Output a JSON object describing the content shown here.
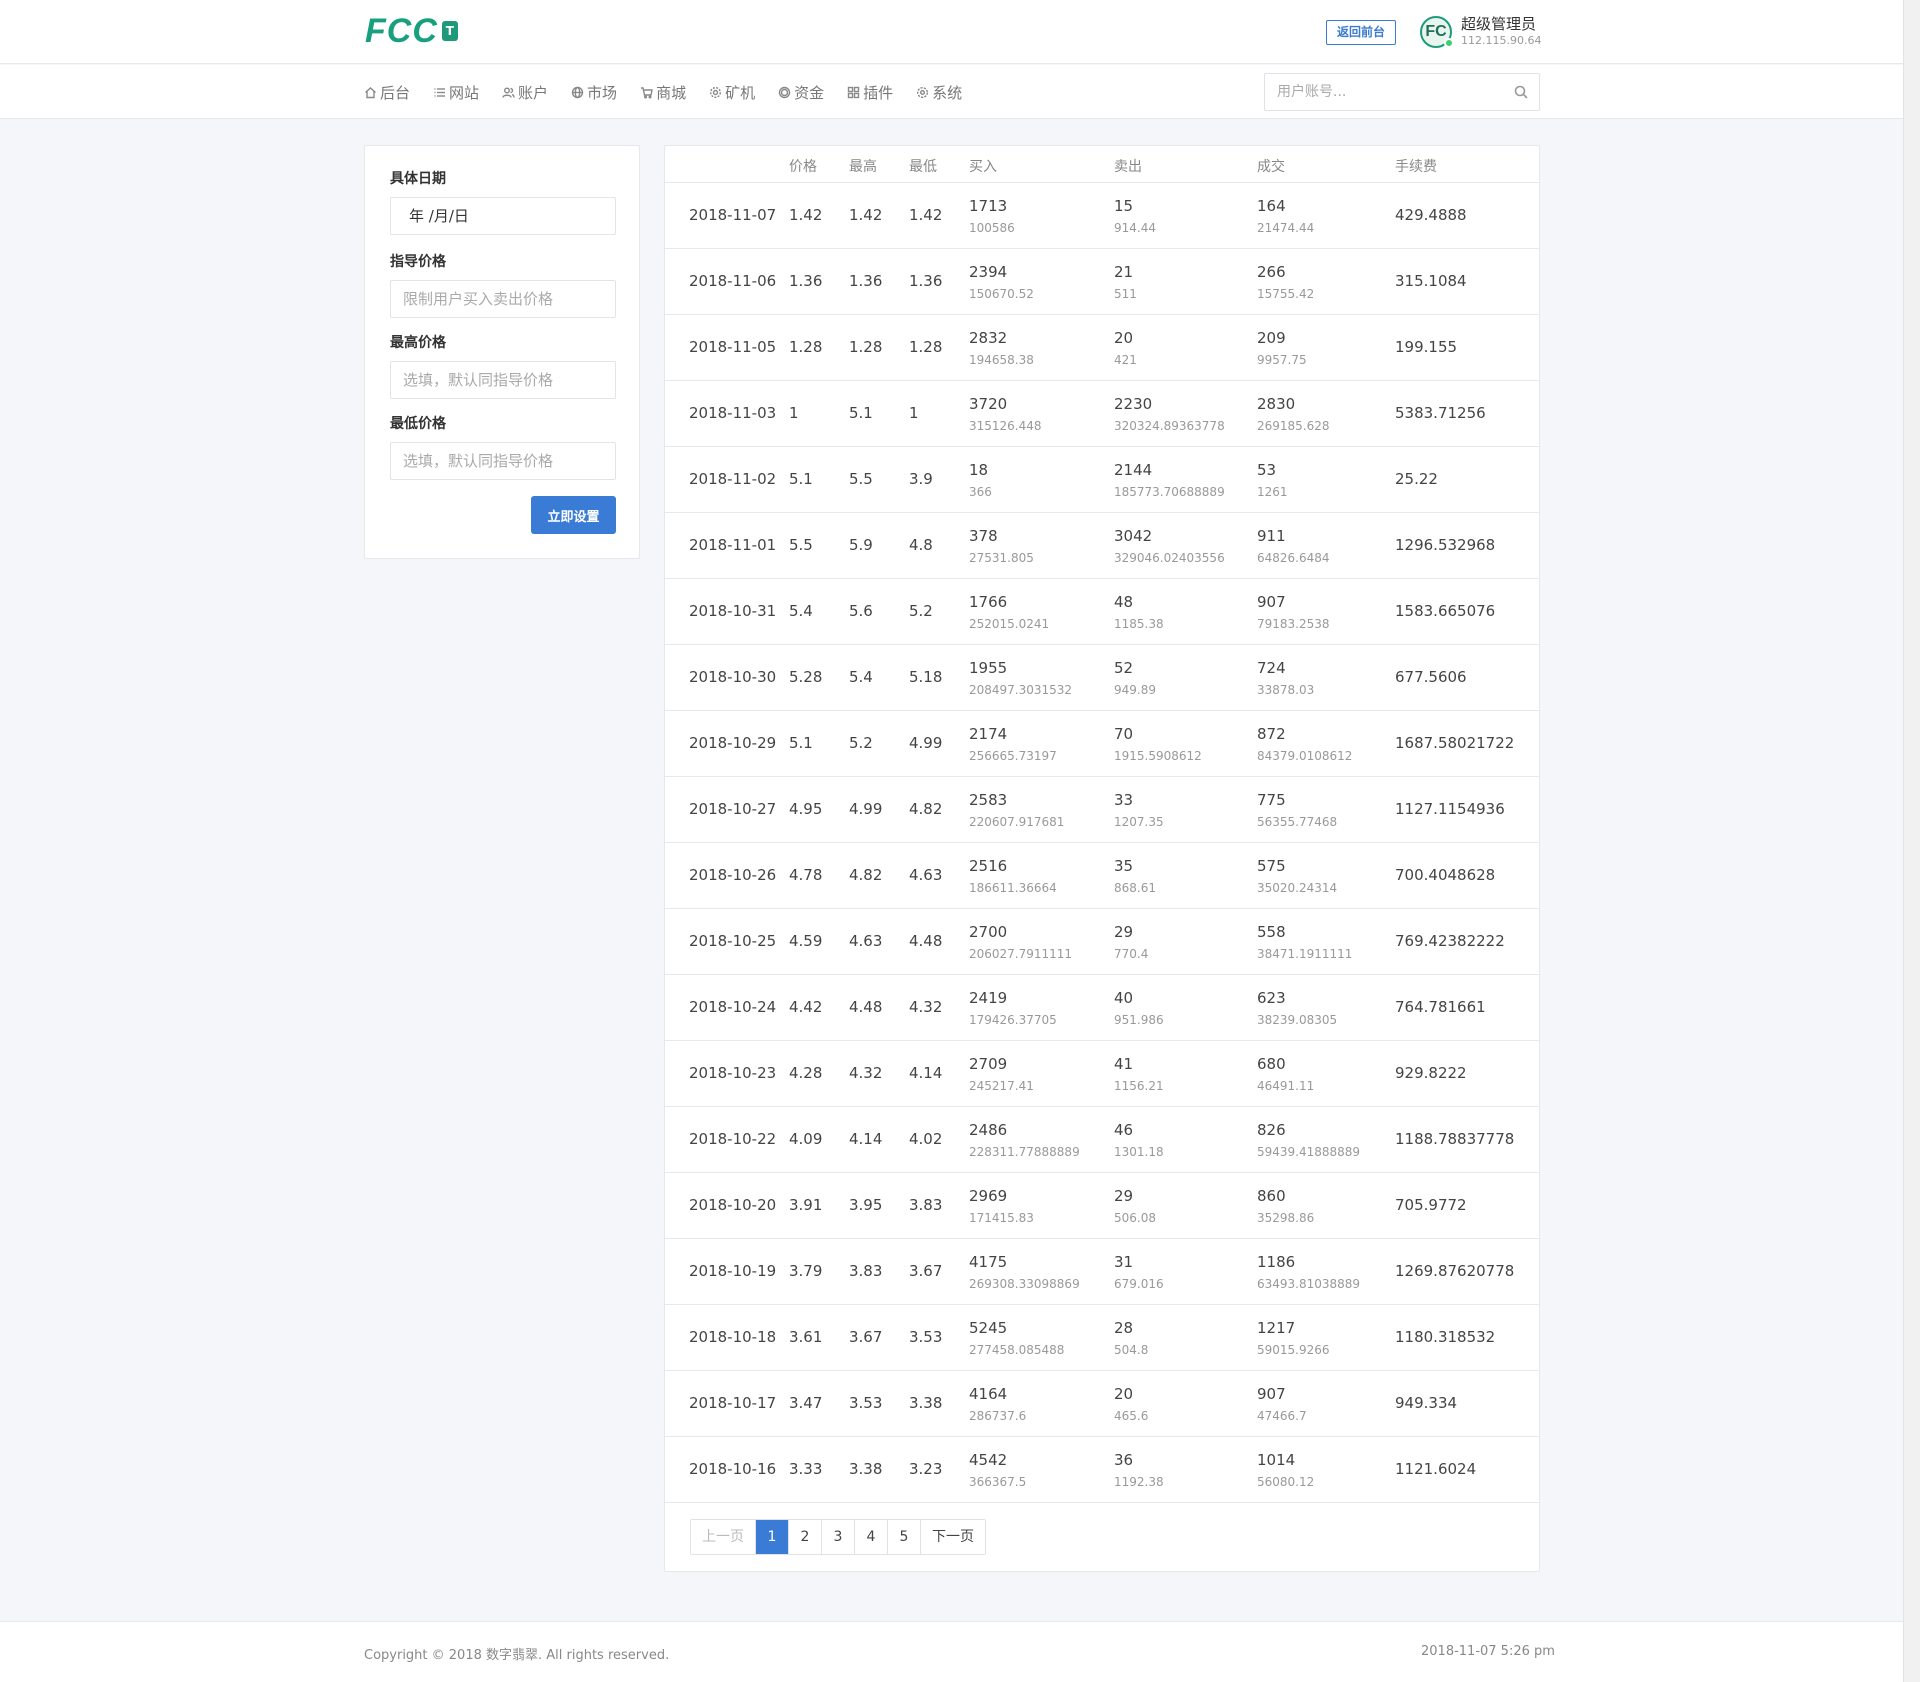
{
  "header": {
    "logo_text": "FCC",
    "logo_badge": "T",
    "front_button": "返回前台",
    "avatar_text": "FC",
    "user_name": "超级管理员",
    "user_ip": "112.115.90.64"
  },
  "nav": {
    "items": [
      {
        "label": "后台",
        "icon": "home-icon"
      },
      {
        "label": "网站",
        "icon": "list-icon"
      },
      {
        "label": "账户",
        "icon": "users-icon"
      },
      {
        "label": "市场",
        "icon": "globe-icon"
      },
      {
        "label": "商城",
        "icon": "cart-icon"
      },
      {
        "label": "矿机",
        "icon": "gear-icon"
      },
      {
        "label": "资金",
        "icon": "coin-icon"
      },
      {
        "label": "插件",
        "icon": "grid-icon"
      },
      {
        "label": "系统",
        "icon": "settings-icon"
      }
    ],
    "search_placeholder": "用户账号..."
  },
  "form": {
    "date_label": "具体日期",
    "date_value": "年 /月/日",
    "guide_label": "指导价格",
    "guide_placeholder": "限制用户买入卖出价格",
    "high_label": "最高价格",
    "high_placeholder": "选填，默认同指导价格",
    "low_label": "最低价格",
    "low_placeholder": "选填，默认同指导价格",
    "submit": "立即设置"
  },
  "table": {
    "headers": [
      "",
      "价格",
      "最高",
      "最低",
      "买入",
      "卖出",
      "成交",
      "手续费"
    ],
    "rows": [
      {
        "date": "2018-11-07",
        "price": "1.42",
        "high": "1.42",
        "low": "1.42",
        "buy": "1713",
        "buy_sub": "100586",
        "sell": "15",
        "sell_sub": "914.44",
        "deal": "164",
        "deal_sub": "21474.44",
        "fee": "429.4888"
      },
      {
        "date": "2018-11-06",
        "price": "1.36",
        "high": "1.36",
        "low": "1.36",
        "buy": "2394",
        "buy_sub": "150670.52",
        "sell": "21",
        "sell_sub": "511",
        "deal": "266",
        "deal_sub": "15755.42",
        "fee": "315.1084"
      },
      {
        "date": "2018-11-05",
        "price": "1.28",
        "high": "1.28",
        "low": "1.28",
        "buy": "2832",
        "buy_sub": "194658.38",
        "sell": "20",
        "sell_sub": "421",
        "deal": "209",
        "deal_sub": "9957.75",
        "fee": "199.155"
      },
      {
        "date": "2018-11-03",
        "price": "1",
        "high": "5.1",
        "low": "1",
        "buy": "3720",
        "buy_sub": "315126.448",
        "sell": "2230",
        "sell_sub": "320324.89363778",
        "deal": "2830",
        "deal_sub": "269185.628",
        "fee": "5383.71256"
      },
      {
        "date": "2018-11-02",
        "price": "5.1",
        "high": "5.5",
        "low": "3.9",
        "buy": "18",
        "buy_sub": "366",
        "sell": "2144",
        "sell_sub": "185773.70688889",
        "deal": "53",
        "deal_sub": "1261",
        "fee": "25.22"
      },
      {
        "date": "2018-11-01",
        "price": "5.5",
        "high": "5.9",
        "low": "4.8",
        "buy": "378",
        "buy_sub": "27531.805",
        "sell": "3042",
        "sell_sub": "329046.02403556",
        "deal": "911",
        "deal_sub": "64826.6484",
        "fee": "1296.532968"
      },
      {
        "date": "2018-10-31",
        "price": "5.4",
        "high": "5.6",
        "low": "5.2",
        "buy": "1766",
        "buy_sub": "252015.0241",
        "sell": "48",
        "sell_sub": "1185.38",
        "deal": "907",
        "deal_sub": "79183.2538",
        "fee": "1583.665076"
      },
      {
        "date": "2018-10-30",
        "price": "5.28",
        "high": "5.4",
        "low": "5.18",
        "buy": "1955",
        "buy_sub": "208497.3031532",
        "sell": "52",
        "sell_sub": "949.89",
        "deal": "724",
        "deal_sub": "33878.03",
        "fee": "677.5606"
      },
      {
        "date": "2018-10-29",
        "price": "5.1",
        "high": "5.2",
        "low": "4.99",
        "buy": "2174",
        "buy_sub": "256665.73197",
        "sell": "70",
        "sell_sub": "1915.5908612",
        "deal": "872",
        "deal_sub": "84379.0108612",
        "fee": "1687.58021722"
      },
      {
        "date": "2018-10-27",
        "price": "4.95",
        "high": "4.99",
        "low": "4.82",
        "buy": "2583",
        "buy_sub": "220607.917681",
        "sell": "33",
        "sell_sub": "1207.35",
        "deal": "775",
        "deal_sub": "56355.77468",
        "fee": "1127.1154936"
      },
      {
        "date": "2018-10-26",
        "price": "4.78",
        "high": "4.82",
        "low": "4.63",
        "buy": "2516",
        "buy_sub": "186611.36664",
        "sell": "35",
        "sell_sub": "868.61",
        "deal": "575",
        "deal_sub": "35020.24314",
        "fee": "700.4048628"
      },
      {
        "date": "2018-10-25",
        "price": "4.59",
        "high": "4.63",
        "low": "4.48",
        "buy": "2700",
        "buy_sub": "206027.7911111",
        "sell": "29",
        "sell_sub": "770.4",
        "deal": "558",
        "deal_sub": "38471.1911111",
        "fee": "769.42382222"
      },
      {
        "date": "2018-10-24",
        "price": "4.42",
        "high": "4.48",
        "low": "4.32",
        "buy": "2419",
        "buy_sub": "179426.37705",
        "sell": "40",
        "sell_sub": "951.986",
        "deal": "623",
        "deal_sub": "38239.08305",
        "fee": "764.781661"
      },
      {
        "date": "2018-10-23",
        "price": "4.28",
        "high": "4.32",
        "low": "4.14",
        "buy": "2709",
        "buy_sub": "245217.41",
        "sell": "41",
        "sell_sub": "1156.21",
        "deal": "680",
        "deal_sub": "46491.11",
        "fee": "929.8222"
      },
      {
        "date": "2018-10-22",
        "price": "4.09",
        "high": "4.14",
        "low": "4.02",
        "buy": "2486",
        "buy_sub": "228311.77888889",
        "sell": "46",
        "sell_sub": "1301.18",
        "deal": "826",
        "deal_sub": "59439.41888889",
        "fee": "1188.78837778"
      },
      {
        "date": "2018-10-20",
        "price": "3.91",
        "high": "3.95",
        "low": "3.83",
        "buy": "2969",
        "buy_sub": "171415.83",
        "sell": "29",
        "sell_sub": "506.08",
        "deal": "860",
        "deal_sub": "35298.86",
        "fee": "705.9772"
      },
      {
        "date": "2018-10-19",
        "price": "3.79",
        "high": "3.83",
        "low": "3.67",
        "buy": "4175",
        "buy_sub": "269308.33098869",
        "sell": "31",
        "sell_sub": "679.016",
        "deal": "1186",
        "deal_sub": "63493.81038889",
        "fee": "1269.87620778"
      },
      {
        "date": "2018-10-18",
        "price": "3.61",
        "high": "3.67",
        "low": "3.53",
        "buy": "5245",
        "buy_sub": "277458.085488",
        "sell": "28",
        "sell_sub": "504.8",
        "deal": "1217",
        "deal_sub": "59015.9266",
        "fee": "1180.318532"
      },
      {
        "date": "2018-10-17",
        "price": "3.47",
        "high": "3.53",
        "low": "3.38",
        "buy": "4164",
        "buy_sub": "286737.6",
        "sell": "20",
        "sell_sub": "465.6",
        "deal": "907",
        "deal_sub": "47466.7",
        "fee": "949.334"
      },
      {
        "date": "2018-10-16",
        "price": "3.33",
        "high": "3.38",
        "low": "3.23",
        "buy": "4542",
        "buy_sub": "366367.5",
        "sell": "36",
        "sell_sub": "1192.38",
        "deal": "1014",
        "deal_sub": "56080.12",
        "fee": "1121.6024"
      }
    ]
  },
  "pagination": {
    "prev": "上一页",
    "pages": [
      "1",
      "2",
      "3",
      "4",
      "5"
    ],
    "active": "1",
    "next": "下一页"
  },
  "footer": {
    "copyright": "Copyright © 2018 数字翡翠. All rights reserved.",
    "datetime": "2018-11-07 5:26 pm"
  },
  "colors": {
    "brand": "#18a07e",
    "accent": "#3a7bd5"
  }
}
